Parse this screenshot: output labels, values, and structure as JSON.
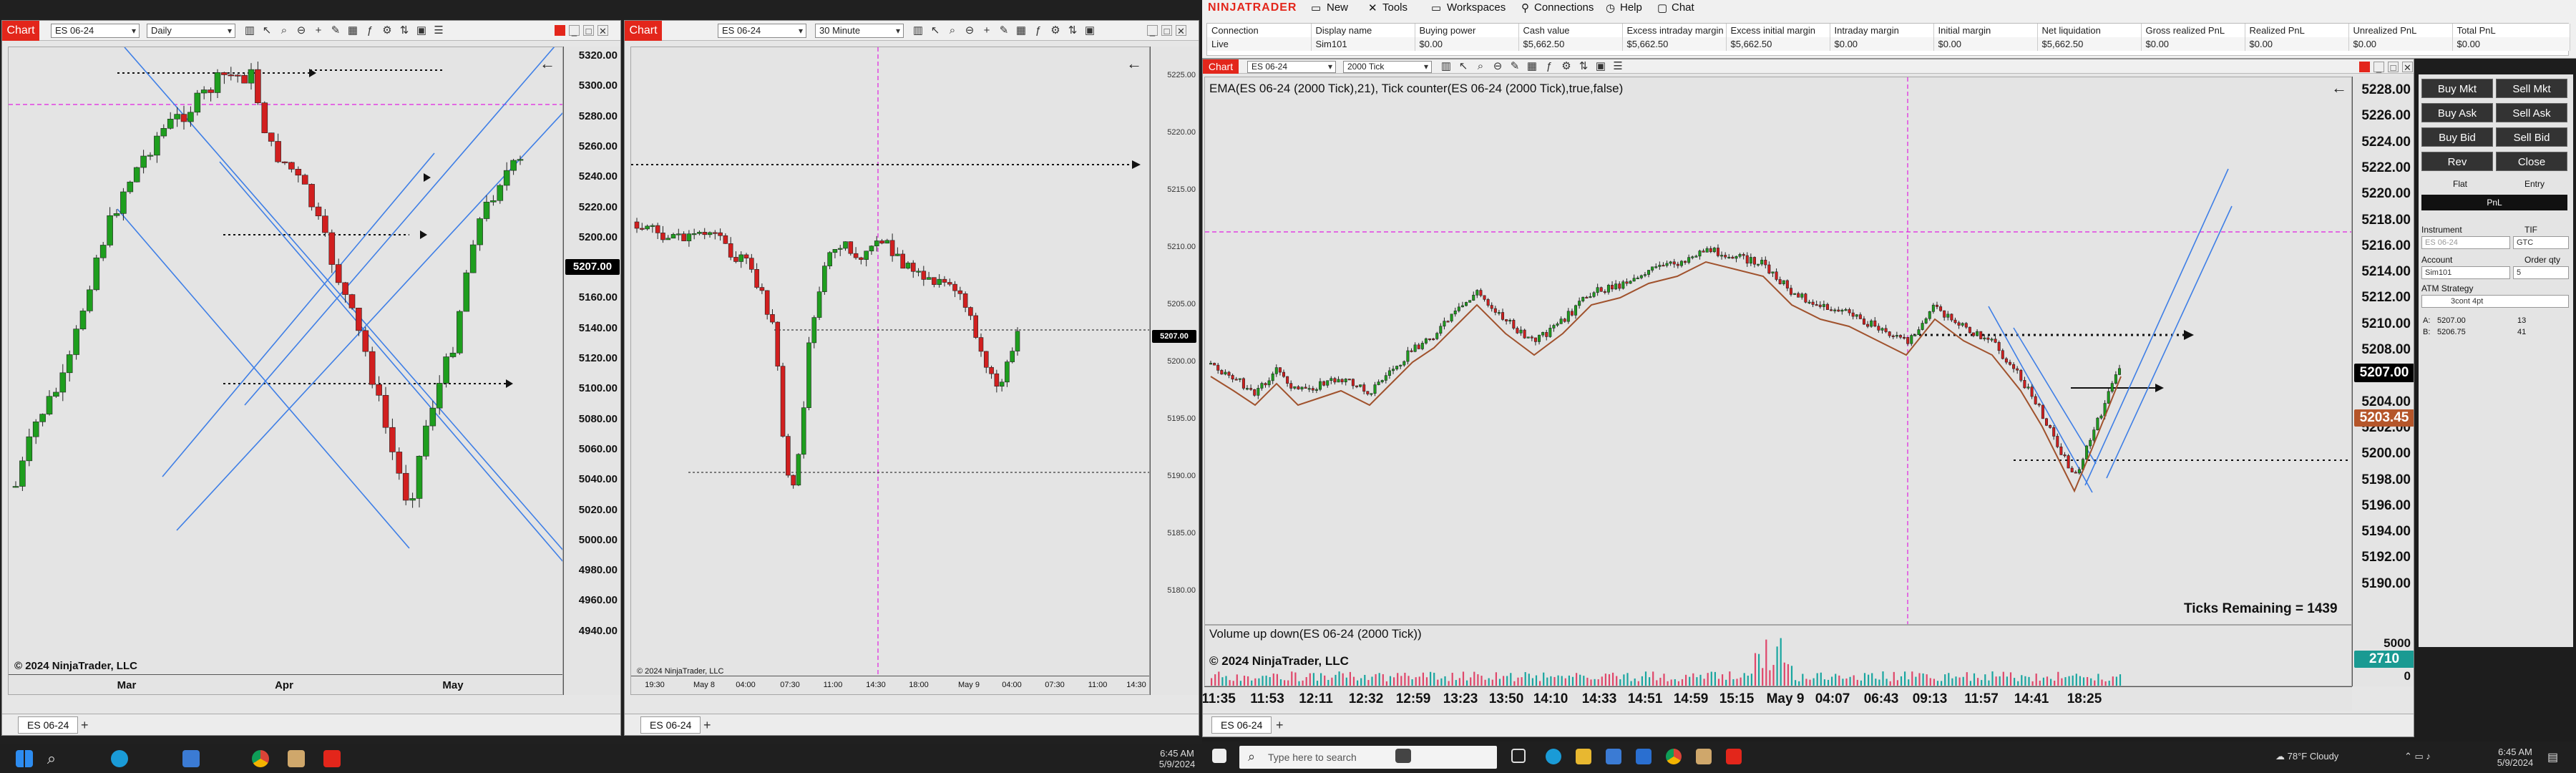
{
  "left": {
    "chart_tab": "Chart",
    "instrument": "ES 06-24",
    "interval": "Daily",
    "price_badge": "5207.00",
    "copyright": "© 2024 NinjaTrader, LLC",
    "tab": "ES 06-24",
    "x_labels": [
      "Mar",
      "Apr",
      "May"
    ],
    "y_labels": [
      "5320.00",
      "5300.00",
      "5280.00",
      "5260.00",
      "5240.00",
      "5220.00",
      "5200.00",
      "5180.00",
      "5160.00",
      "5140.00",
      "5120.00",
      "5100.00",
      "5080.00",
      "5060.00",
      "5040.00",
      "5020.00",
      "5000.00",
      "4980.00",
      "4960.00",
      "4940.00"
    ]
  },
  "mid": {
    "chart_tab": "Chart",
    "instrument": "ES 06-24",
    "interval": "30 Minute",
    "price_badge": "5207.00",
    "copyright": "© 2024 NinjaTrader, LLC",
    "tab": "ES 06-24",
    "x_labels": [
      "19:30",
      "May 8",
      "04:00",
      "07:30",
      "11:00",
      "14:30",
      "18:00",
      "May 9",
      "04:00",
      "07:30",
      "11:00",
      "14:30"
    ],
    "y_labels": [
      "5225.00",
      "5220.00",
      "5215.00",
      "5210.00",
      "5205.00",
      "5200.00",
      "5195.00",
      "5190.00",
      "5185.00",
      "5180.00"
    ]
  },
  "right": {
    "logo": "NINJATRADER",
    "menu": [
      {
        "icon": "new-icon",
        "label": "New"
      },
      {
        "icon": "tools-icon",
        "label": "Tools"
      },
      {
        "icon": "workspaces-icon",
        "label": "Workspaces"
      },
      {
        "icon": "connections-icon",
        "label": "Connections"
      },
      {
        "icon": "help-icon",
        "label": "Help"
      },
      {
        "icon": "chat-icon",
        "label": "Chat"
      }
    ],
    "accounts": {
      "headers": [
        "Connection",
        "Display name",
        "Buying power",
        "Cash value",
        "Excess intraday margin",
        "Excess initial margin",
        "Intraday margin",
        "Initial margin",
        "Net liquidation",
        "Gross realized PnL",
        "Realized PnL",
        "Unrealized PnL",
        "Total PnL"
      ],
      "row": [
        "Live",
        "Sim101",
        "$0.00",
        "$5,662.50",
        "$5,662.50",
        "$5,662.50",
        "$0.00",
        "$0.00",
        "$5,662.50",
        "$0.00",
        "$0.00",
        "$0.00",
        "$0.00"
      ]
    },
    "chart_tab": "Chart",
    "instrument": "ES 06-24",
    "interval": "2000 Tick",
    "indicator_label": "EMA(ES 06-24 (2000 Tick),21), Tick counter(ES 06-24 (2000 Tick),true,false)",
    "ticks_remaining": "Ticks Remaining = 1439",
    "volume_label": "Volume up down(ES 06-24 (2000 Tick))",
    "copyright": "© 2024 NinjaTrader, LLC",
    "price_badge": "5207.00",
    "ema_badge": "5203.45",
    "volume_badge": "2710",
    "volume_axis": [
      "5000",
      "0"
    ],
    "tab": "ES 06-24",
    "x_labels": [
      "11:35",
      "11:53",
      "12:11",
      "12:32",
      "12:59",
      "13:23",
      "13:50",
      "14:10",
      "14:33",
      "14:51",
      "14:59",
      "15:15",
      "May 9",
      "04:07",
      "06:43",
      "09:13",
      "11:57",
      "14:41",
      "18:25"
    ],
    "y_labels": [
      "5228.00",
      "5226.00",
      "5224.00",
      "5222.00",
      "5220.00",
      "5218.00",
      "5216.00",
      "5214.00",
      "5212.00",
      "5210.00",
      "5208.00",
      "5206.00",
      "5204.00",
      "5202.00",
      "5200.00",
      "5198.00",
      "5196.00",
      "5194.00",
      "5192.00",
      "5190.00"
    ],
    "order": {
      "buttons": [
        "Buy Mkt",
        "Sell Mkt",
        "Buy Ask",
        "Sell Ask",
        "Buy Bid",
        "Sell Bid",
        "Rev",
        "Close"
      ],
      "flat": "Flat",
      "entry": "Entry",
      "pnl": "PnL",
      "instrument_label": "Instrument",
      "instrument_value": "ES 06-24",
      "tif_label": "TIF",
      "tif_value": "GTC",
      "account_label": "Account",
      "account_value": "Sim101",
      "qty_label": "Order qty",
      "qty_value": "5",
      "atm_label": "ATM Strategy",
      "atm_value": "3cont 4pt",
      "ask_label": "A:",
      "ask_price": "5207.00",
      "ask_size": "13",
      "bid_label": "B:",
      "bid_price": "5206.75",
      "bid_size": "41"
    }
  },
  "taskbar_left": {
    "time": "6:45 AM",
    "date": "5/9/2024"
  },
  "taskbar_right": {
    "search_placeholder": "Type here to search",
    "weather": "78°F  Cloudy",
    "time": "6:45 AM",
    "date": "5/9/2024"
  },
  "colors": {
    "up": "#1e9e1e",
    "down": "#d11f1f",
    "brand": "#e3261b",
    "magenta": "#e020e0",
    "channel": "#3f7fe6"
  }
}
